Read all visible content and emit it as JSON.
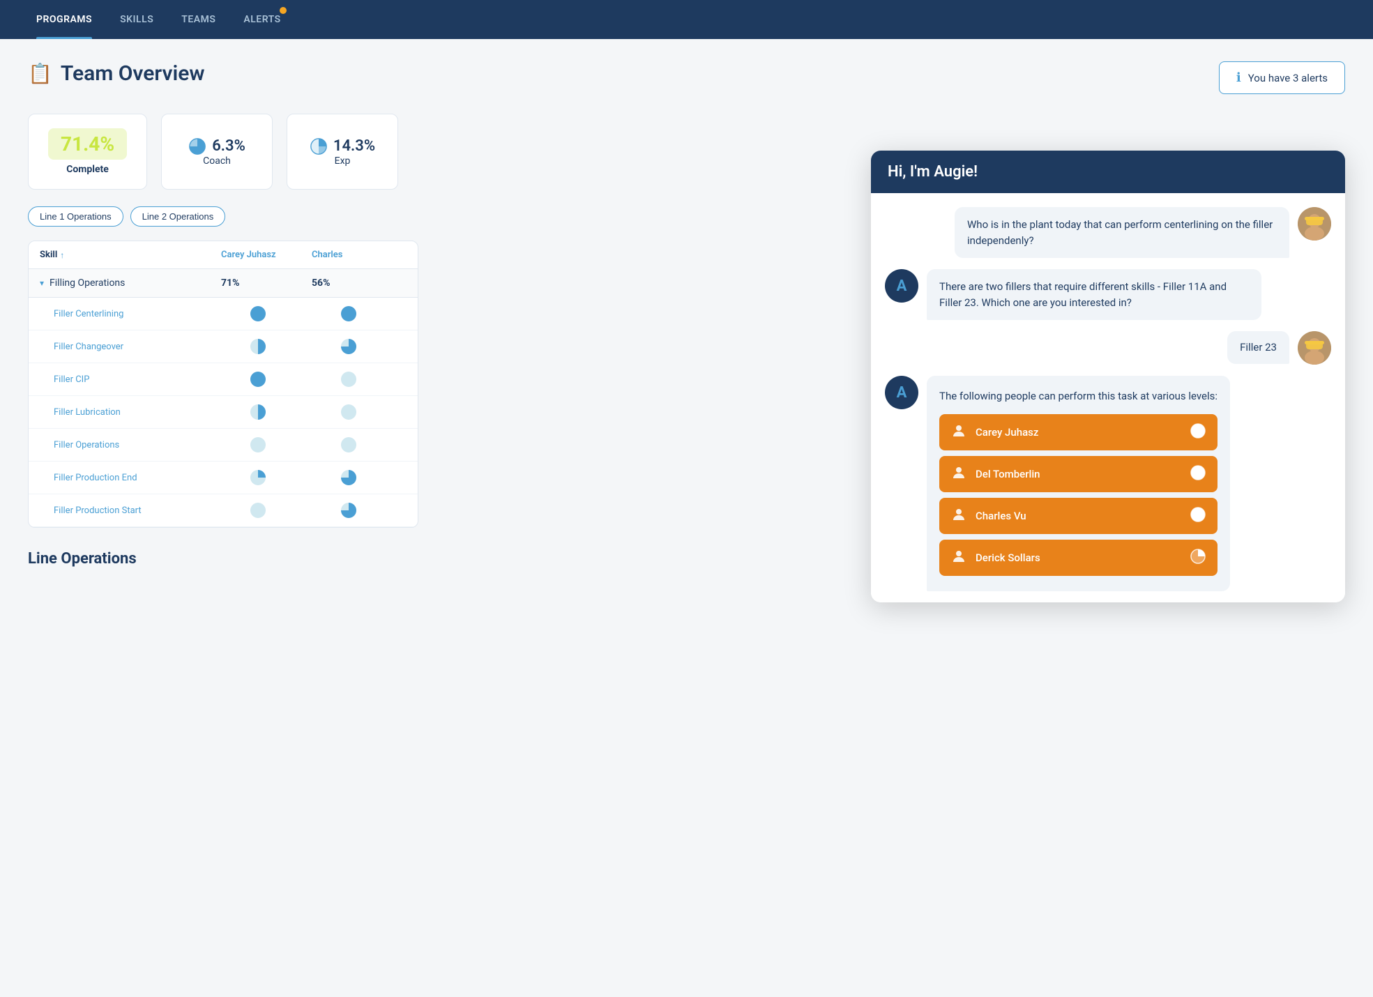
{
  "nav": {
    "items": [
      {
        "id": "programs",
        "label": "PROGRAMS",
        "active": true
      },
      {
        "id": "skills",
        "label": "SKILLS",
        "active": false
      },
      {
        "id": "teams",
        "label": "TEAMS",
        "active": false
      },
      {
        "id": "alerts",
        "label": "ALERTS",
        "active": false,
        "badge": true
      }
    ]
  },
  "page": {
    "title": "Team Overview",
    "alerts_text": "You have 3 alerts"
  },
  "stats": [
    {
      "id": "complete",
      "value": "71.4%",
      "label": "Complete",
      "type": "highlight"
    },
    {
      "id": "coach",
      "value": "6.3%",
      "label": "Coach",
      "type": "pie"
    },
    {
      "id": "exp",
      "value": "14.3%",
      "label": "Exp",
      "type": "pie-half"
    }
  ],
  "filters": [
    {
      "id": "line1",
      "label": "Line 1 Operations"
    },
    {
      "id": "line2",
      "label": "Line 2 Operations"
    }
  ],
  "table": {
    "col_skill": "Skill",
    "col_carey": "Carey Juhasz",
    "col_charles": "Charles",
    "groups": [
      {
        "id": "filling",
        "name": "Filling Operations",
        "pct_carey": "71%",
        "pct_charles": "56%",
        "skills": [
          {
            "name": "Filler Centerlining",
            "carey": "full",
            "charles": "full"
          },
          {
            "name": "Filler Changeover",
            "carey": "half",
            "charles": "three-quarter"
          },
          {
            "name": "Filler CIP",
            "carey": "full",
            "charles": "empty"
          },
          {
            "name": "Filler Lubrication",
            "carey": "half",
            "charles": "empty"
          },
          {
            "name": "Filler Operations",
            "carey": "empty",
            "charles": "empty"
          },
          {
            "name": "Filler Production End",
            "carey": "quarter",
            "charles": "three-quarter"
          },
          {
            "name": "Filler Production Start",
            "carey": "empty",
            "charles": "three-quarter"
          }
        ]
      }
    ]
  },
  "line_ops_label": "Line Operations",
  "chat": {
    "header": "Hi, I'm Augie!",
    "messages": [
      {
        "type": "user",
        "text": "Who is in the plant today that can perform centerlining on the filler independenly?"
      },
      {
        "type": "bot",
        "text": "There are two fillers that require different skills - Filler 11A and Filler 23.  Which one are you interested in?"
      },
      {
        "type": "user",
        "text": "Filler 23"
      },
      {
        "type": "bot-people",
        "text": "The following people can perform this task at various levels:",
        "people": [
          {
            "name": "Carey Juhasz",
            "icon": "full"
          },
          {
            "name": "Del Tomberlin",
            "icon": "full"
          },
          {
            "name": "Charles Vu",
            "icon": "full"
          },
          {
            "name": "Derick Sollars",
            "icon": "half"
          }
        ]
      }
    ]
  }
}
